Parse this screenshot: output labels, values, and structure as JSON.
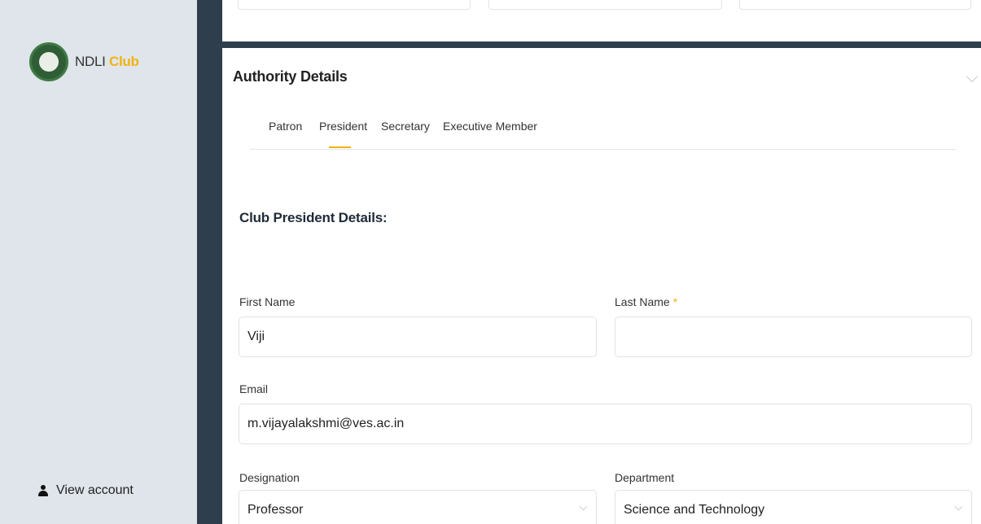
{
  "brand": {
    "name_prefix": "NDLI",
    "name_suffix": "Club",
    "accent_color": "#f2b211"
  },
  "sidebar": {
    "view_account_label": "View account"
  },
  "section": {
    "title": "Authority Details"
  },
  "tabs": [
    {
      "label": "Patron",
      "active": false
    },
    {
      "label": "President",
      "active": true
    },
    {
      "label": "Secretary",
      "active": false
    },
    {
      "label": "Executive Member",
      "active": false
    }
  ],
  "form": {
    "heading": "Club President Details:",
    "first_name": {
      "label": "First Name",
      "value": "Viji"
    },
    "last_name": {
      "label": "Last Name",
      "required_marker": "*",
      "value": ""
    },
    "email": {
      "label": "Email",
      "value": "m.vijayalakshmi@ves.ac.in"
    },
    "designation": {
      "label": "Designation",
      "value": "Professor"
    },
    "department": {
      "label": "Department",
      "value": "Science and Technology"
    }
  }
}
